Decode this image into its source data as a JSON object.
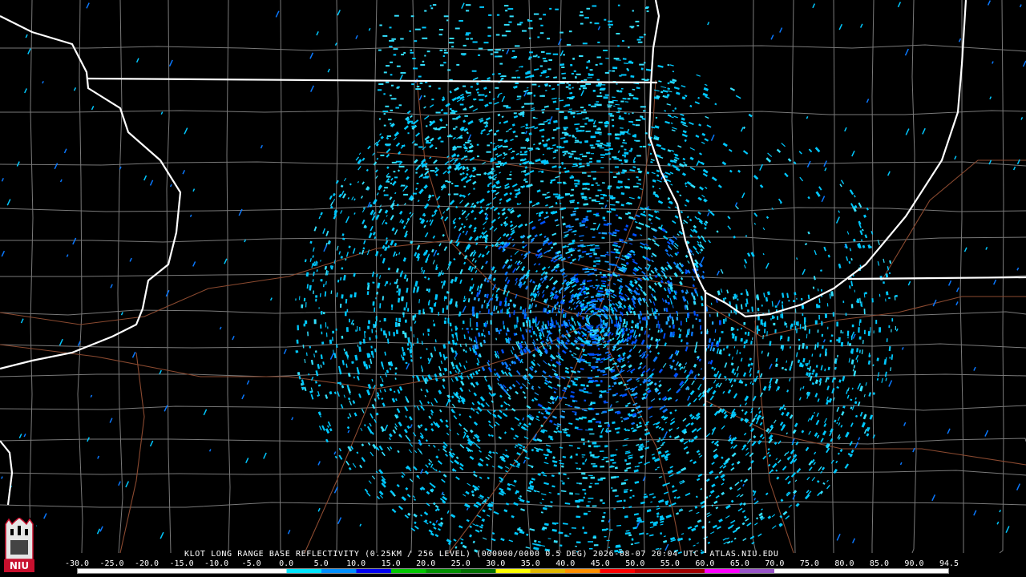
{
  "product_caption": "KLOT LONG RANGE BASE REFLECTIVITY (0.25KM / 256 LEVEL) (000000/0000 0.5 DEG) 2026-08-07 20:04 UTC  ATLAS.NIU.EDU",
  "scale": {
    "labels": [
      "-30.0",
      "-25.0",
      "-20.0",
      "-15.0",
      "-10.0",
      "-5.0",
      "0.0",
      "5.0",
      "10.0",
      "15.0",
      "20.0",
      "25.0",
      "30.0",
      "35.0",
      "40.0",
      "45.0",
      "50.0",
      "55.0",
      "60.0",
      "65.0",
      "70.0",
      "75.0",
      "80.0",
      "85.0",
      "90.0",
      "94.5"
    ],
    "colors": [
      "#ffffff",
      "#ffffff",
      "#ffffff",
      "#ffffff",
      "#ffffff",
      "#ffffff",
      "#00e5ff",
      "#0090ff",
      "#0000f0",
      "#00c800",
      "#009000",
      "#007000",
      "#ffff00",
      "#e0b800",
      "#ff9000",
      "#ff0000",
      "#c00000",
      "#a00000",
      "#ff00ff",
      "#9955c9",
      "#ffffff",
      "#ffffff",
      "#ffffff",
      "#ffffff",
      "#ffffff"
    ]
  },
  "logo": {
    "text": "NIU",
    "color": "#c8102e"
  },
  "map": {
    "radar_site": "KLOT",
    "echo_colors": [
      "#00c8ff",
      "#0a78ff",
      "#33e0ff",
      "#1fa8ff",
      "#0050ff",
      "#2e8b57"
    ],
    "state_line_color": "#ffffff",
    "county_line_color": "#8a8a8a",
    "road_color": "#9a5a3a"
  }
}
